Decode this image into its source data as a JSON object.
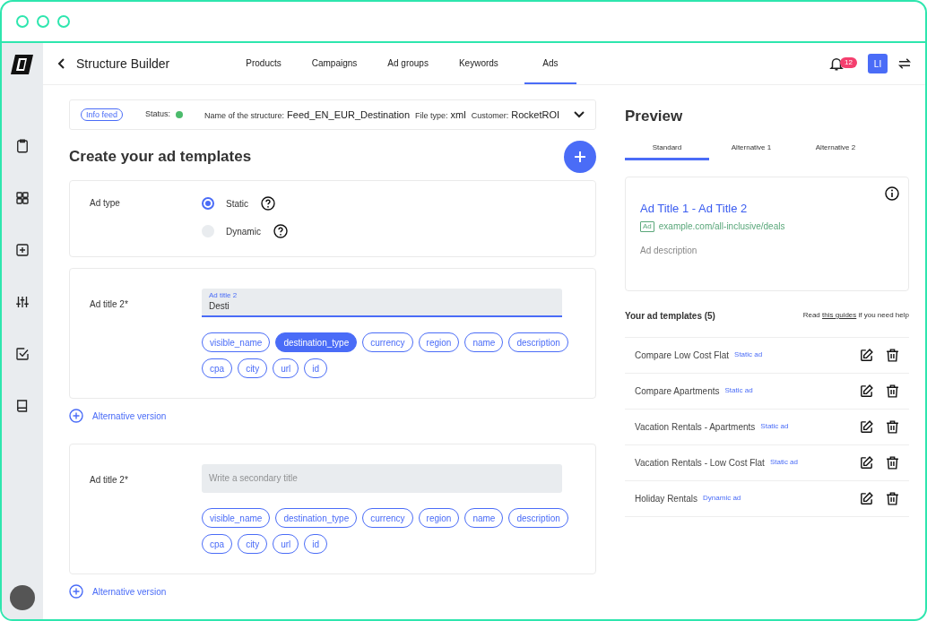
{
  "header": {
    "title": "Structure Builder",
    "nav": [
      {
        "label": "Products",
        "selected": false
      },
      {
        "label": "Campaigns",
        "selected": false
      },
      {
        "label": "Ad groups",
        "selected": false
      },
      {
        "label": "Keywords",
        "selected": false
      },
      {
        "label": "Ads",
        "selected": true
      }
    ],
    "notification_count": "12",
    "user_initials": "LI"
  },
  "sidebar": {
    "items": [
      {
        "kind": "clipboard",
        "selected": false
      },
      {
        "kind": "grid",
        "selected": false
      },
      {
        "kind": "plus",
        "selected": false
      },
      {
        "kind": "sliders",
        "selected": false
      },
      {
        "kind": "check",
        "selected": false
      },
      {
        "kind": "book",
        "selected": false
      }
    ]
  },
  "info_bar": {
    "badge": "Info feed",
    "status_label": "Status:",
    "status_active": true,
    "fields": [
      {
        "label": "Name of the structure:",
        "value": "Feed_EN_EUR_Destination"
      },
      {
        "label": "File type:",
        "value": "xml"
      },
      {
        "label": "Customer:",
        "value": "RocketROI"
      }
    ]
  },
  "editor": {
    "title": "Create your ad templates",
    "ad_type": {
      "label": "Ad type",
      "options": [
        {
          "label": "Static",
          "selected": true
        },
        {
          "label": "Dynamic",
          "selected": false
        }
      ]
    },
    "blocks": [
      {
        "label": "Ad title 2*",
        "field": {
          "floating_label": "Ad title 2",
          "value": "Desti",
          "focused": true
        },
        "tags": [
          {
            "label": "visible_name",
            "selected": false
          },
          {
            "label": "destination_type",
            "selected": true
          },
          {
            "label": "currency",
            "selected": false
          },
          {
            "label": "region",
            "selected": false
          },
          {
            "label": "name",
            "selected": false
          },
          {
            "label": "description",
            "selected": false
          },
          {
            "label": "cpa",
            "selected": false
          },
          {
            "label": "city",
            "selected": false
          },
          {
            "label": "url",
            "selected": false
          },
          {
            "label": "id",
            "selected": false
          }
        ],
        "add_link": "Alternative version"
      },
      {
        "label": "Ad title 2*",
        "field": {
          "placeholder": "Write a secondary title",
          "focused": false
        },
        "tags": [
          {
            "label": "visible_name",
            "selected": false
          },
          {
            "label": "destination_type",
            "selected": false
          },
          {
            "label": "currency",
            "selected": false
          },
          {
            "label": "region",
            "selected": false
          },
          {
            "label": "name",
            "selected": false
          },
          {
            "label": "description",
            "selected": false
          },
          {
            "label": "cpa",
            "selected": false
          },
          {
            "label": "city",
            "selected": false
          },
          {
            "label": "url",
            "selected": false
          },
          {
            "label": "id",
            "selected": false
          }
        ],
        "add_link": "Alternative version"
      }
    ]
  },
  "preview": {
    "title": "Preview",
    "tabs": [
      {
        "label": "Standard",
        "selected": true
      },
      {
        "label": "Alternative 1",
        "selected": false
      },
      {
        "label": "Alternative 2",
        "selected": false
      }
    ],
    "ad": {
      "title": "Ad Title 1 - Ad Title 2",
      "badge": "Ad",
      "url": "example.com/all-inclusive/deals",
      "description": "Ad description"
    },
    "templates_title": "Your ad templates (5)",
    "help_before": "Read",
    "help_link": "this guides",
    "help_after": "if you need help",
    "templates": [
      {
        "name": "Compare Low Cost Flat",
        "type": "Static ad"
      },
      {
        "name": "Compare Apartments",
        "type": "Static ad"
      },
      {
        "name": "Vacation Rentals - Apartments",
        "type": "Static ad"
      },
      {
        "name": "Vacation Rentals - Low Cost Flat",
        "type": "Static ad"
      },
      {
        "name": "Holiday Rentals",
        "type": "Dynamic ad"
      }
    ]
  }
}
